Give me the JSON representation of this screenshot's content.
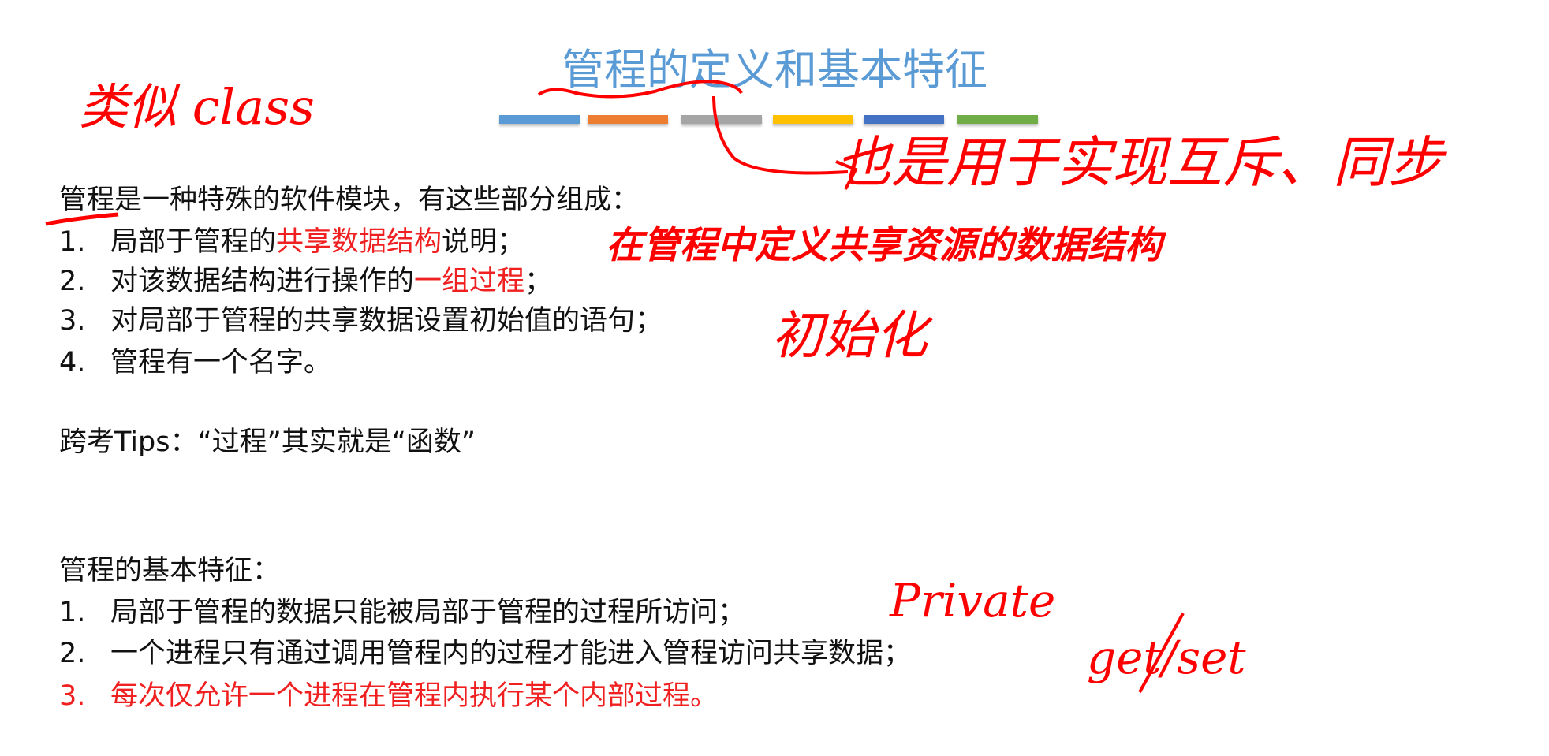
{
  "title": "管程的定义和基本特征",
  "bar_colors": [
    "#5b9bd5",
    "#ed7d31",
    "#a5a5a5",
    "#ffc000",
    "#4472c4",
    "#70ad47"
  ],
  "definition": {
    "intro": "管程是一种特殊的软件模块，有这些部分组成：",
    "items": [
      {
        "num": "1.",
        "pre": "局部于管程的",
        "highlight": "共享数据结构",
        "post": "说明；"
      },
      {
        "num": "2.",
        "pre": "对该数据结构进行操作的",
        "highlight": "一组过程",
        "post": "；"
      },
      {
        "num": "3.",
        "pre": "对局部于管程的共享数据设置初始值的语句；",
        "highlight": "",
        "post": ""
      },
      {
        "num": "4.",
        "pre": "管程有一个名字。",
        "highlight": "",
        "post": ""
      }
    ]
  },
  "tips": "跨考Tips：“过程”其实就是“函数”",
  "features": {
    "heading": "管程的基本特征：",
    "items": [
      {
        "num": "1.",
        "text": "局部于管程的数据只能被局部于管程的过程所访问；"
      },
      {
        "num": "2.",
        "text": "一个进程只有通过调用管程内的过程才能进入管程访问共享数据；"
      },
      {
        "num": "3.",
        "text": "每次仅允许一个进程在管程内执行某个内部过程。"
      }
    ]
  },
  "annotations": {
    "class_note": "类似 class",
    "mutex_note": "也是用于实现互斥、同步",
    "shared_note": "在管程中定义共享资源的数据结构",
    "init_note": "初始化",
    "private_note": "Private",
    "getset_note": "get/set"
  },
  "colors": {
    "title": "#5b9bd5",
    "highlight": "#f02020",
    "ink": "#ff0000"
  }
}
